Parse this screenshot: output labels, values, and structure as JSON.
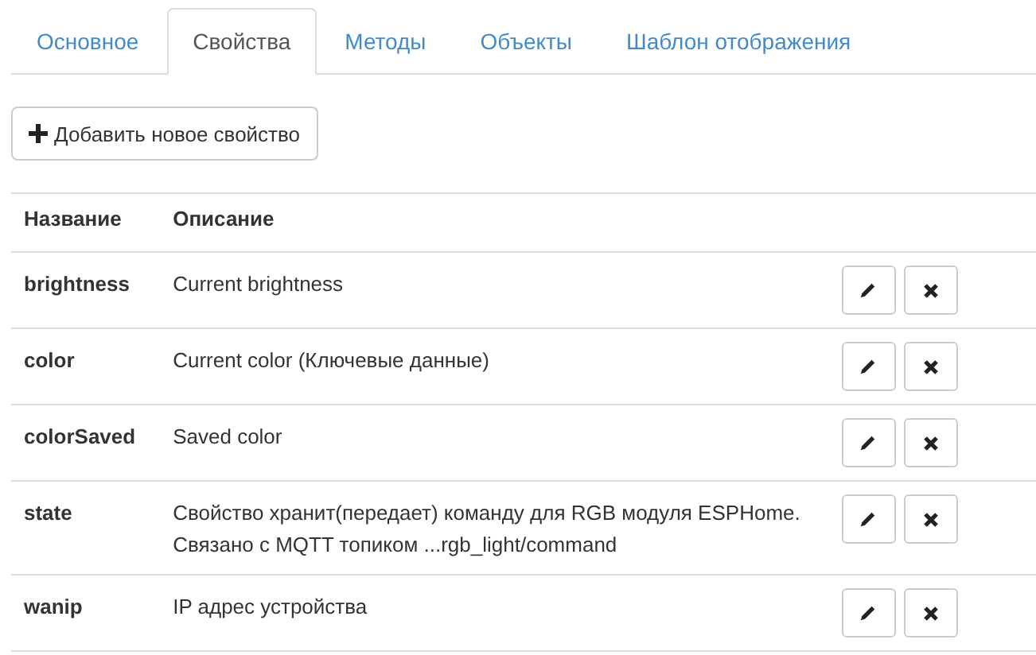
{
  "tabs": [
    {
      "label": "Основное",
      "selected": false
    },
    {
      "label": "Свойства",
      "selected": true
    },
    {
      "label": "Методы",
      "selected": false
    },
    {
      "label": "Объекты",
      "selected": false
    },
    {
      "label": "Шаблон отображения",
      "selected": false
    }
  ],
  "add_button": {
    "label": "Добавить новое свойство"
  },
  "table": {
    "columns": [
      "Название",
      "Описание"
    ],
    "rows": [
      {
        "name": "brightness",
        "description": "Current brightness"
      },
      {
        "name": "color",
        "description": "Current color (Ключевые данные)"
      },
      {
        "name": "colorSaved",
        "description": "Saved color"
      },
      {
        "name": "state",
        "description": "Свойство хранит(передает) команду для RGB модуля ESPHome. Связано с MQTT топиком ...rgb_light/command"
      },
      {
        "name": "wanip",
        "description": "IP адрес устройства"
      }
    ]
  }
}
